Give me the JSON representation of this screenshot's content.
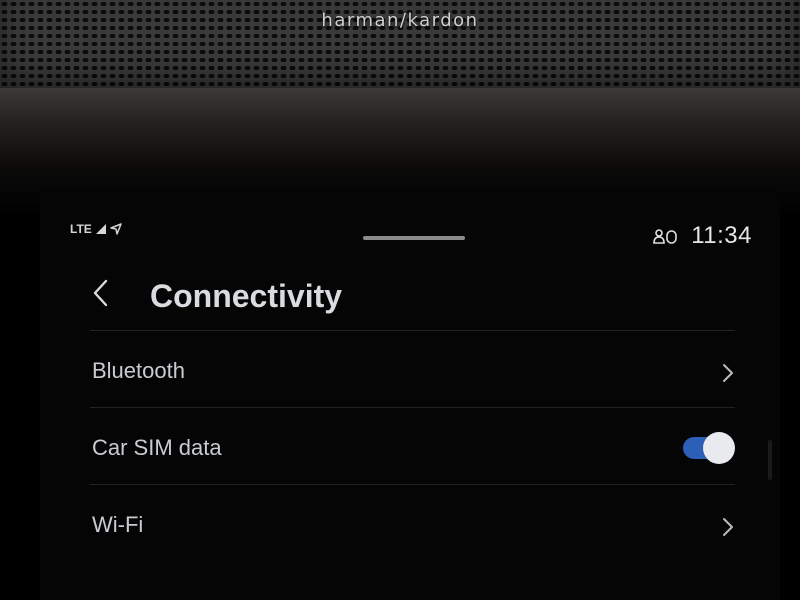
{
  "brand": {
    "logo_text": "harman/kardon"
  },
  "status_bar": {
    "network": "LTE",
    "signal_icon": "signal-icon",
    "location_icon": "navigation-arrow-icon",
    "profile_icon": "driver-profile-icon",
    "time": "11:34"
  },
  "header": {
    "back_icon": "chevron-left-icon",
    "title": "Connectivity"
  },
  "settings": {
    "items": [
      {
        "label": "Bluetooth",
        "control": "chevron-right-icon"
      },
      {
        "label": "Car SIM data",
        "control": "toggle",
        "on": true
      },
      {
        "label": "Wi-Fi",
        "control": "chevron-right-icon"
      }
    ]
  },
  "colors": {
    "toggle_on": "#2c5fb8",
    "title_text": "#d8dce0",
    "row_text": "#c8ccd2"
  }
}
